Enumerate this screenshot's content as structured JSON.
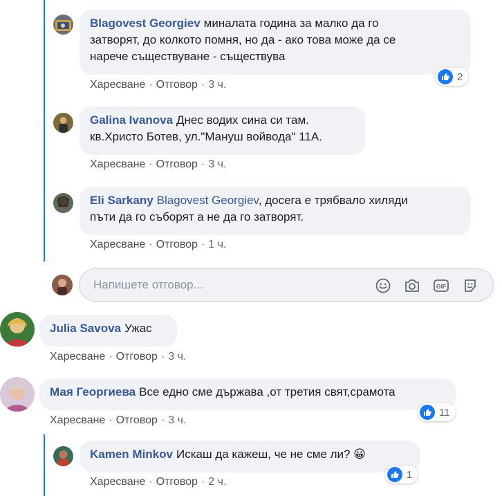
{
  "comments": [
    {
      "author": "Blagovest Georgiev",
      "text_lines": [
        "миналата година за малко да го",
        "затворят, до колкото помня, но да - ако това може да се",
        "нарече съществуване - съществува"
      ],
      "actions": {
        "like": "Харесване",
        "reply": "Отговор",
        "time": "3 ч."
      },
      "reactions": "2"
    },
    {
      "author": "Galina Ivanova",
      "text_lines": [
        "Днес водих сина си там.",
        "кв.Христо Ботев, ул.\"Мануш войвода\" 11А."
      ],
      "actions": {
        "like": "Харесване",
        "reply": "Отговор",
        "time": "3 ч."
      }
    },
    {
      "author": "Eli Sarkany",
      "mention": "Blagovest Georgiev",
      "text_lines": [
        ", досега е трябвало хиляди",
        "пъти да го съборят а не да го затворят."
      ],
      "actions": {
        "like": "Харесване",
        "reply": "Отговор",
        "time": "1 ч."
      }
    },
    {
      "author": "Julia Savova",
      "text_lines": [
        "Ужас"
      ],
      "actions": {
        "like": "Харесване",
        "reply": "Отговор",
        "time": "3 ч."
      }
    },
    {
      "author": "Мая Георгиева",
      "text_lines": [
        "Все едно сме държава ,от третия свят,срамота"
      ],
      "actions": {
        "like": "Харесване",
        "reply": "Отговор",
        "time": "3 ч."
      },
      "reactions": "11"
    },
    {
      "author": "Kamen Minkov",
      "text_lines": [
        "Искаш да кажеш, че не сме ли? "
      ],
      "emoji": "😀",
      "actions": {
        "like": "Харесване",
        "reply": "Отговор",
        "time": "2 ч."
      },
      "reactions": "1"
    }
  ],
  "reply_box": {
    "placeholder": "Напишете отговор...",
    "icons": [
      "emoji-icon",
      "camera-icon",
      "gif-icon",
      "sticker-icon"
    ],
    "gif_label": "GIF"
  },
  "colors": {
    "accent": "#1877f2",
    "author": "#385898",
    "bubble": "#f0f2f5",
    "meta": "#606770"
  }
}
